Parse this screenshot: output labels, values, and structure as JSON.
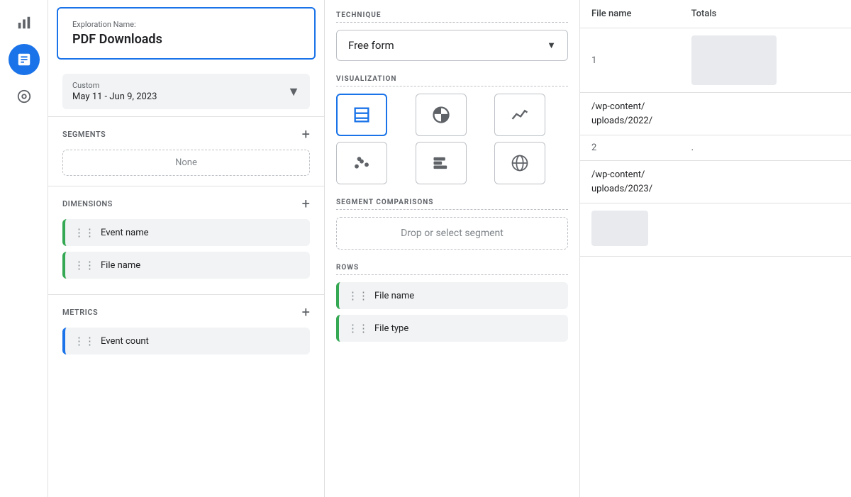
{
  "sidebar": {
    "items": [
      {
        "id": "bar-chart",
        "icon": "bar_chart",
        "active": false
      },
      {
        "id": "analytics",
        "icon": "analytics",
        "active": true
      },
      {
        "id": "target",
        "icon": "target",
        "active": false
      }
    ]
  },
  "left_panel": {
    "exploration_label": "Exploration Name:",
    "exploration_title": "PDF Downloads",
    "date_range": {
      "label": "Custom",
      "value": "May 11 - Jun 9, 2023"
    },
    "segments": {
      "title": "SEGMENTS",
      "none_label": "None"
    },
    "dimensions": {
      "title": "DIMENSIONS",
      "items": [
        {
          "label": "Event name"
        },
        {
          "label": "File name"
        }
      ]
    },
    "metrics": {
      "title": "METRICS",
      "items": [
        {
          "label": "Event count"
        }
      ]
    }
  },
  "middle_panel": {
    "technique": {
      "label": "TECHNIQUE",
      "value": "Free form"
    },
    "visualization": {
      "label": "VISUALIZATION",
      "buttons": [
        {
          "id": "table",
          "active": true
        },
        {
          "id": "pie",
          "active": false
        },
        {
          "id": "line",
          "active": false
        },
        {
          "id": "scatter",
          "active": false
        },
        {
          "id": "bar-h",
          "active": false
        },
        {
          "id": "globe",
          "active": false
        }
      ]
    },
    "segment_comparisons": {
      "label": "SEGMENT COMPARISONS",
      "drop_label": "Drop or select segment"
    },
    "rows": {
      "label": "ROWS",
      "items": [
        {
          "label": "File name"
        },
        {
          "label": "File type"
        }
      ]
    }
  },
  "right_panel": {
    "column_header": "File name",
    "totals_header": "Totals",
    "rows": [
      {
        "number": "1",
        "path": "/wp-content/\nuploads/2022/"
      },
      {
        "number": "2",
        "path": "/wp-content/\nuploads/2023/"
      }
    ]
  }
}
